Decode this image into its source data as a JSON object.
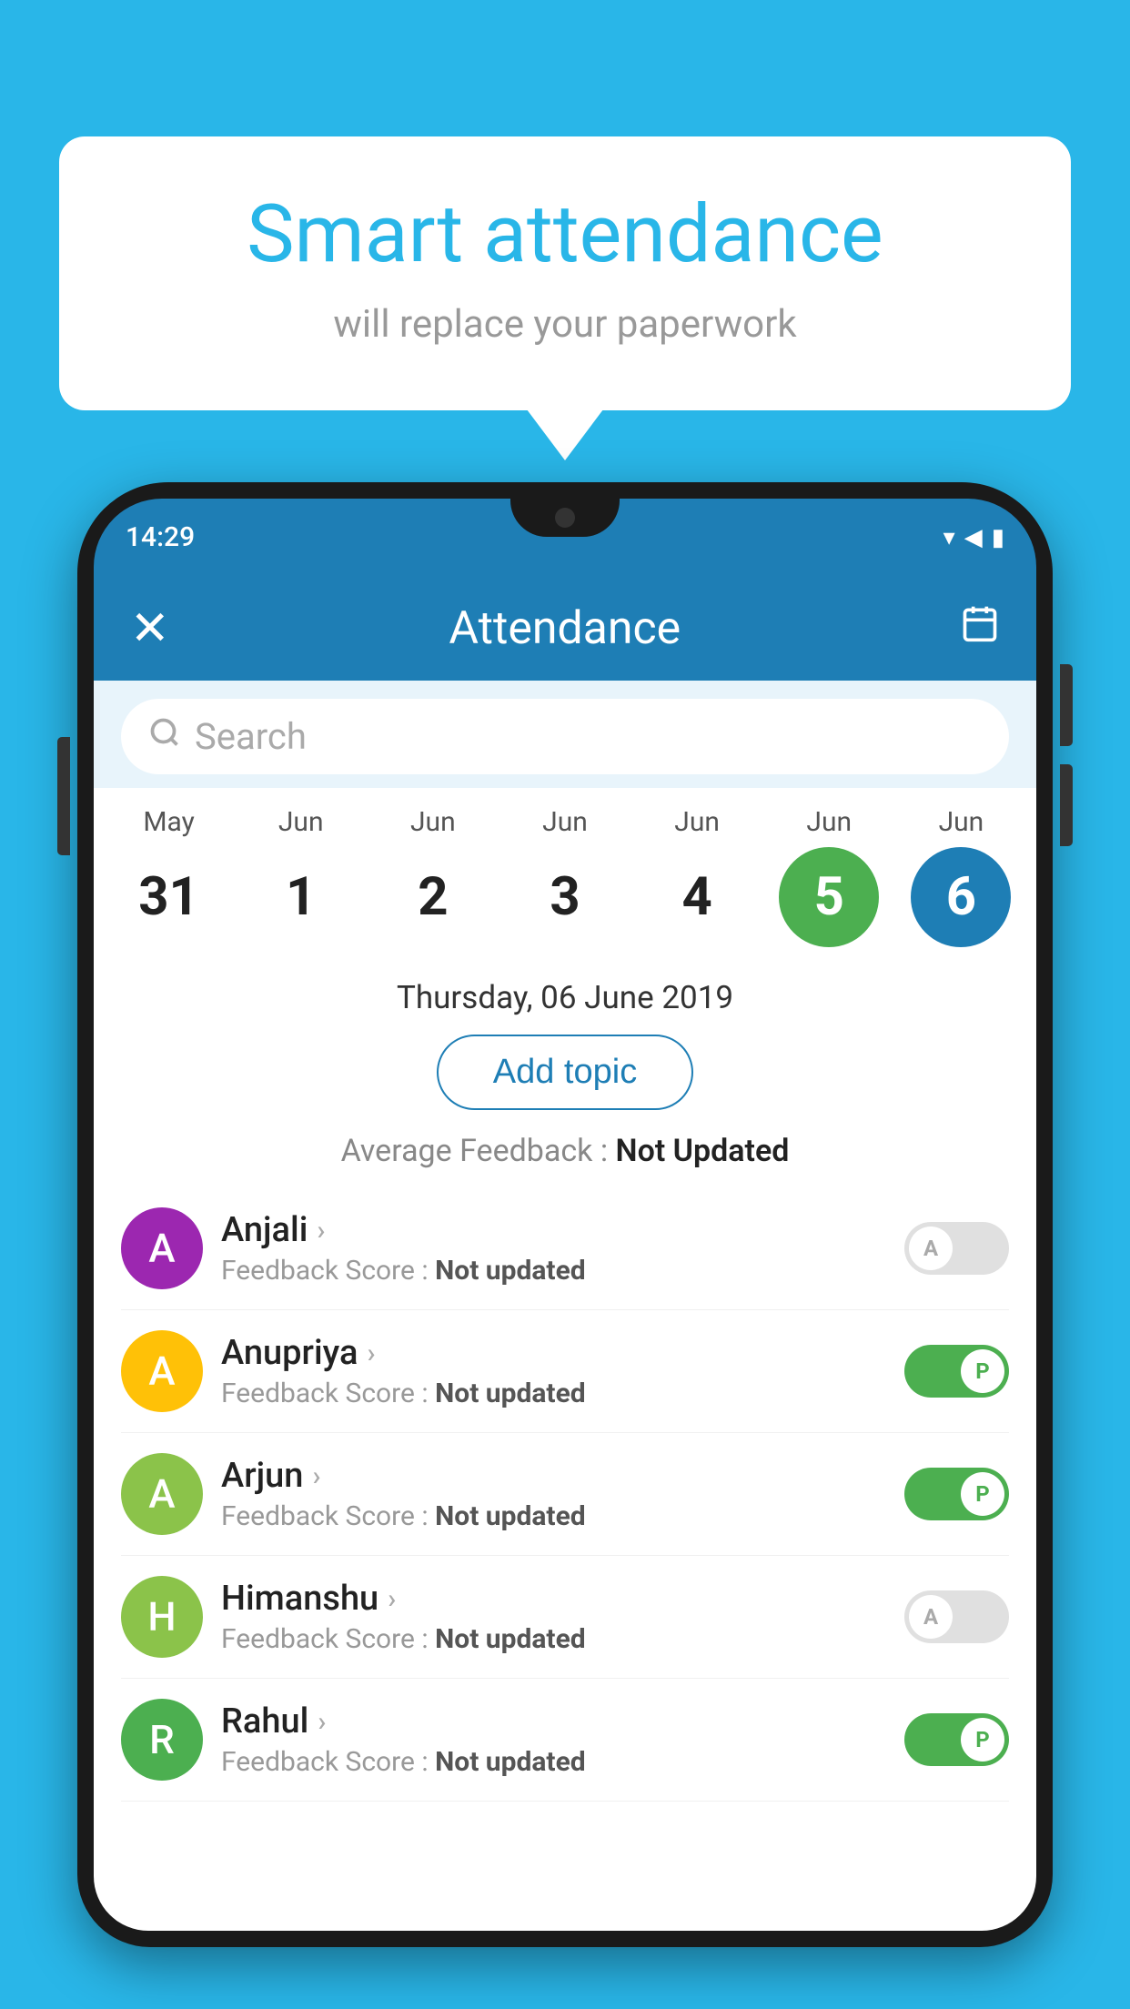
{
  "background_color": "#29b6e8",
  "bubble": {
    "title": "Smart attendance",
    "subtitle": "will replace your paperwork"
  },
  "status_bar": {
    "time": "14:29",
    "wifi": "▾",
    "signal": "◀",
    "battery": "▮"
  },
  "header": {
    "close_label": "✕",
    "title": "Attendance",
    "calendar_icon": "📅"
  },
  "search": {
    "placeholder": "Search"
  },
  "calendar": {
    "days": [
      {
        "month": "May",
        "date": "31",
        "state": "normal"
      },
      {
        "month": "Jun",
        "date": "1",
        "state": "normal"
      },
      {
        "month": "Jun",
        "date": "2",
        "state": "normal"
      },
      {
        "month": "Jun",
        "date": "3",
        "state": "normal"
      },
      {
        "month": "Jun",
        "date": "4",
        "state": "normal"
      },
      {
        "month": "Jun",
        "date": "5",
        "state": "today"
      },
      {
        "month": "Jun",
        "date": "6",
        "state": "selected"
      }
    ]
  },
  "selected_date_label": "Thursday, 06 June 2019",
  "add_topic_label": "Add topic",
  "average_feedback": {
    "label": "Average Feedback : ",
    "value": "Not Updated"
  },
  "students": [
    {
      "name": "Anjali",
      "avatar_letter": "A",
      "avatar_color": "#9c27b0",
      "feedback_label": "Feedback Score : ",
      "feedback_value": "Not updated",
      "attendance": "absent"
    },
    {
      "name": "Anupriya",
      "avatar_letter": "A",
      "avatar_color": "#ffc107",
      "feedback_label": "Feedback Score : ",
      "feedback_value": "Not updated",
      "attendance": "present"
    },
    {
      "name": "Arjun",
      "avatar_letter": "A",
      "avatar_color": "#8bc34a",
      "feedback_label": "Feedback Score : ",
      "feedback_value": "Not updated",
      "attendance": "present"
    },
    {
      "name": "Himanshu",
      "avatar_letter": "H",
      "avatar_color": "#8bc34a",
      "feedback_label": "Feedback Score : ",
      "feedback_value": "Not updated",
      "attendance": "absent"
    },
    {
      "name": "Rahul",
      "avatar_letter": "R",
      "avatar_color": "#4caf50",
      "feedback_label": "Feedback Score : ",
      "feedback_value": "Not updated",
      "attendance": "present"
    }
  ]
}
